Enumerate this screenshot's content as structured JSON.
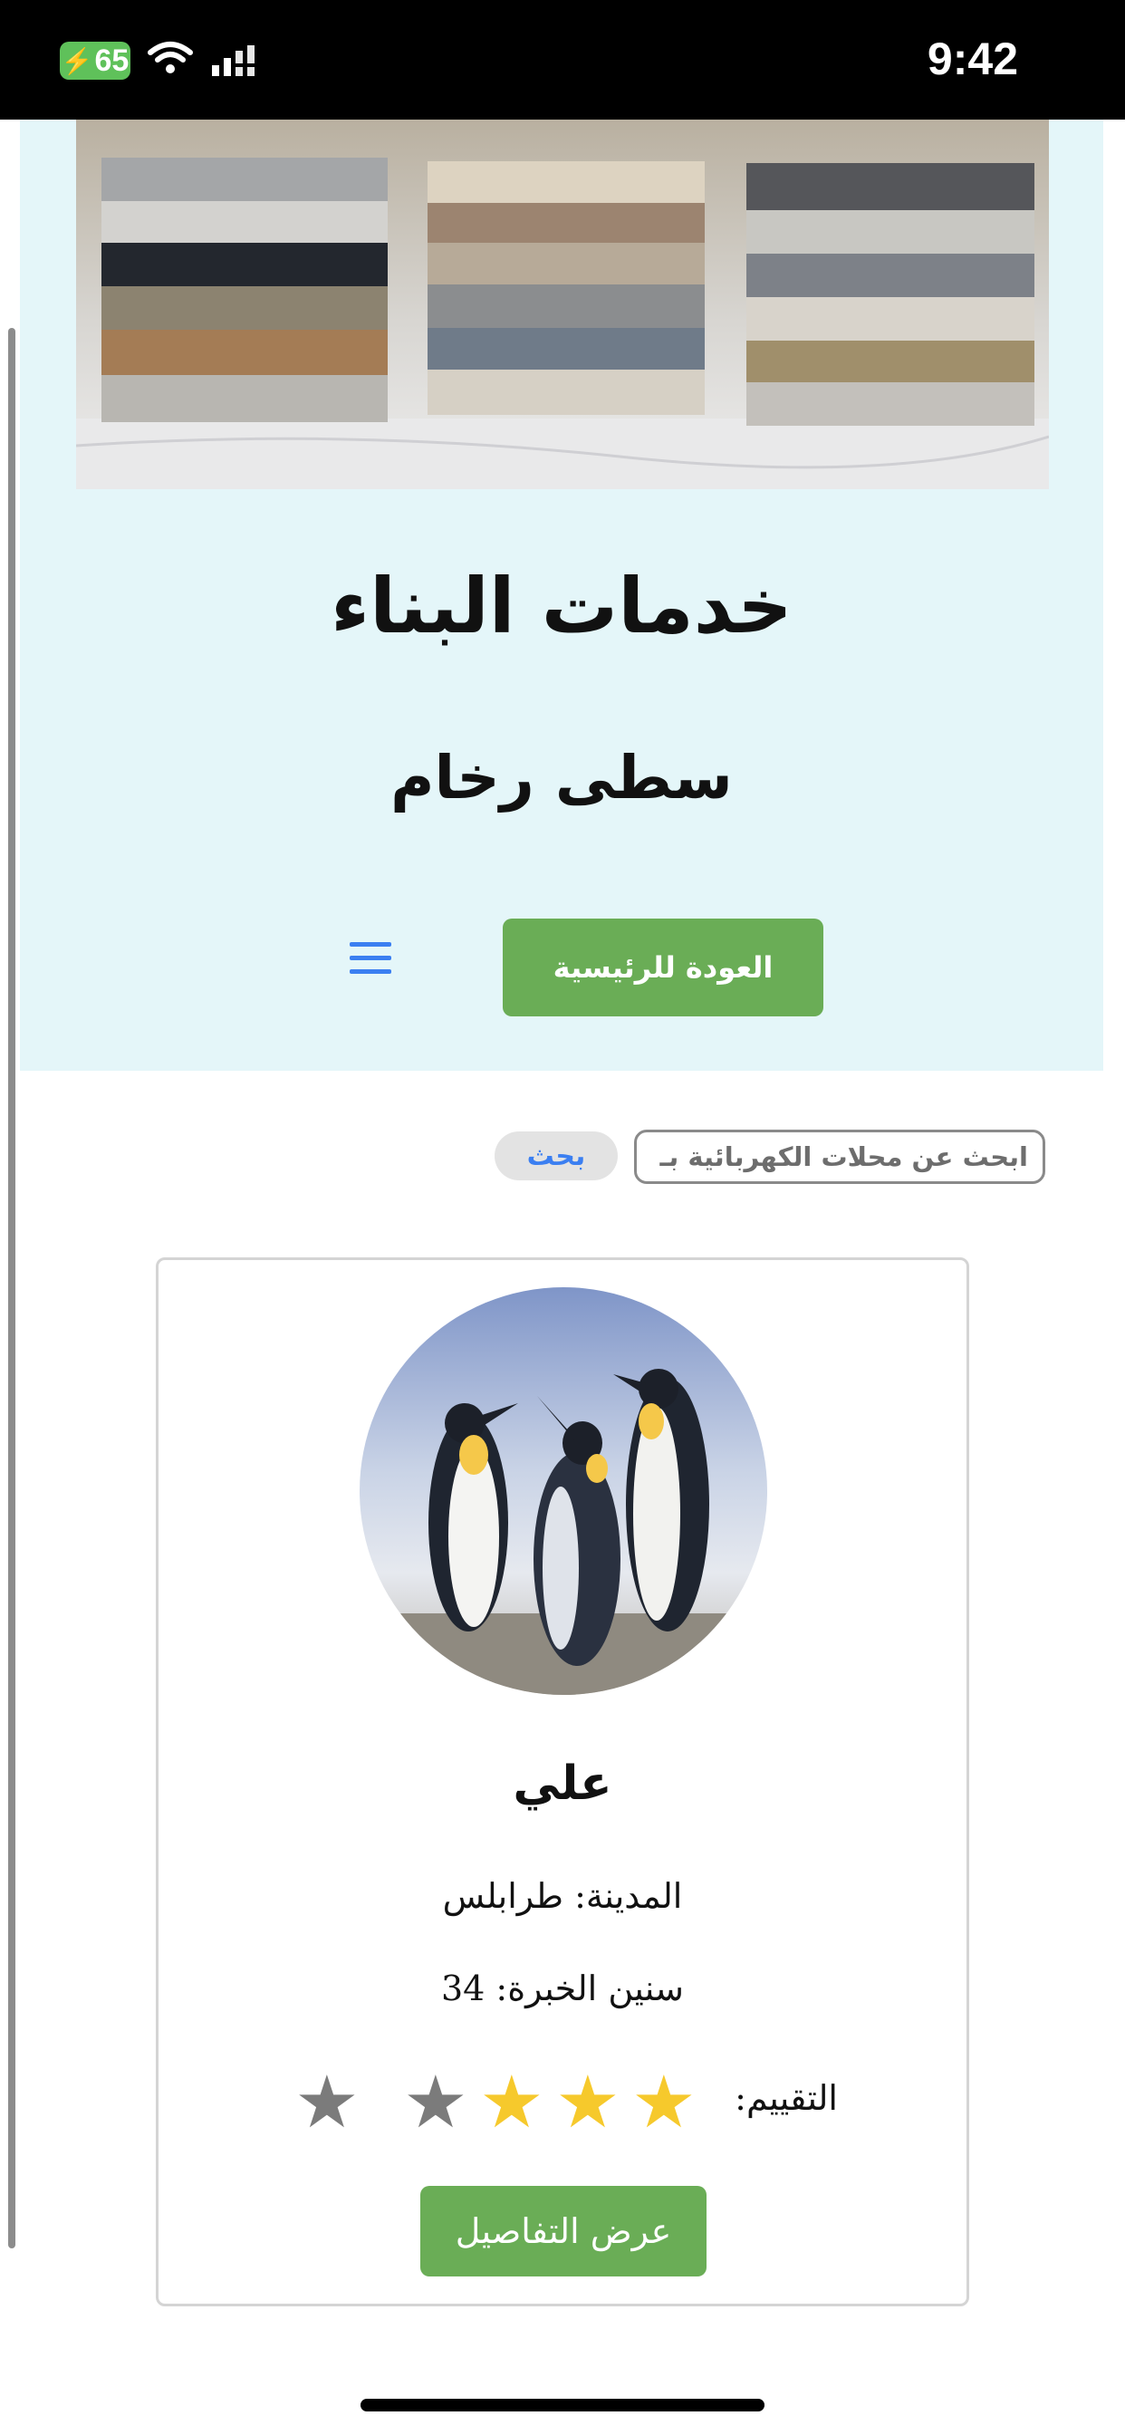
{
  "status_bar": {
    "battery": "65",
    "time": "9:42"
  },
  "header": {
    "hero_image": "marble-samples-image",
    "title": "خدمات البناء",
    "subtitle": "سطى رخام",
    "home_button_label": "العودة للرئيسية",
    "menu_icon": "hamburger-menu-icon"
  },
  "search": {
    "placeholder": "ابحث عن محلات الكهربائية بـ",
    "button_label": "بحث"
  },
  "card": {
    "avatar_image": "penguins-photo",
    "name": "علي",
    "city": "المدينة: طرابلس",
    "experience": "سنين الخبرة: 34",
    "rating_label": "التقييم:",
    "rating": 3,
    "rating_max": 5,
    "details_button_label": "عرض التفاصيل"
  },
  "colors": {
    "header_background": "#e4f6f9",
    "button_green": "#6aad56",
    "link_blue": "#3b7ff1",
    "star_on": "#f6c92c",
    "star_off": "#7b7b7b"
  }
}
